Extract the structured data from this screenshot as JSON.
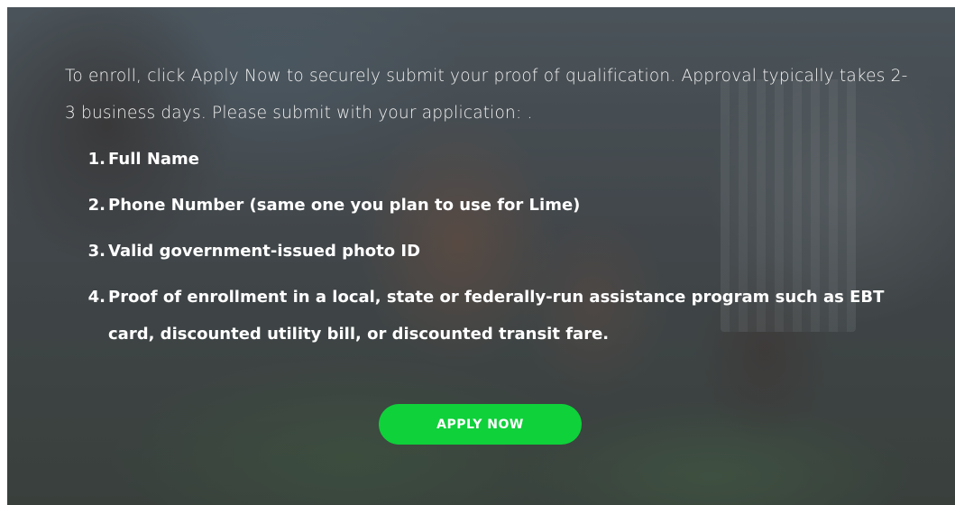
{
  "intro": {
    "text": "To enroll, click Apply Now to securely submit your proof of qualification. Approval typically takes 2-3 business days. Please submit with your application: ."
  },
  "requirements": [
    {
      "number": "1.",
      "text": "Full Name"
    },
    {
      "number": "2.",
      "text": "Phone Number (same one you plan to use for Lime)"
    },
    {
      "number": "3.",
      "text": "Valid government-issued photo ID"
    },
    {
      "number": "4.",
      "text": "Proof of enrollment in a local, state or federally-run assistance program such as EBT card, discounted utility bill, or discounted transit fare."
    }
  ],
  "cta": {
    "label": "APPLY NOW",
    "color": "#0fd13a"
  }
}
